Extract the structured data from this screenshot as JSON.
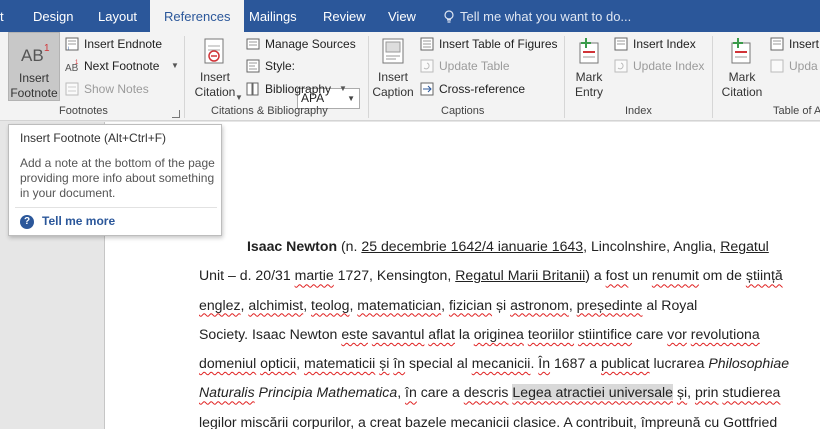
{
  "tabs": [
    {
      "label": "t"
    },
    {
      "label": "Design"
    },
    {
      "label": "Layout"
    },
    {
      "label": "References"
    },
    {
      "label": "Mailings"
    },
    {
      "label": "Review"
    },
    {
      "label": "View"
    }
  ],
  "tell_me": {
    "placeholder": "Tell me what you want to do..."
  },
  "ribbon": {
    "footnotes": {
      "insert_footnote": "Insert\nFootnote",
      "insert_endnote": "Insert Endnote",
      "next_footnote": "Next Footnote",
      "show_notes": "Show Notes",
      "title": "Footnotes"
    },
    "citations": {
      "insert_citation": "Insert\nCitation",
      "manage_sources": "Manage Sources",
      "style_label": "Style:",
      "style_value": "APA",
      "bibliography": "Bibliography",
      "title": "Citations & Bibliography"
    },
    "captions": {
      "insert_caption": "Insert\nCaption",
      "insert_table_of_figures": "Insert Table of Figures",
      "update_table": "Update Table",
      "cross_reference": "Cross-reference",
      "title": "Captions"
    },
    "index": {
      "mark_entry": "Mark\nEntry",
      "insert_index": "Insert Index",
      "update_index": "Update Index",
      "title": "Index"
    },
    "toa": {
      "mark_citation": "Mark\nCitation",
      "insert": "Insert",
      "update": "Upda",
      "title": "Table of A"
    }
  },
  "tooltip": {
    "title": "Insert Footnote (Alt+Ctrl+F)",
    "body": "Add a note at the bottom of the page providing more info about something in your document.",
    "link": "Tell me more"
  },
  "document": {
    "lines": [
      [
        {
          "t": "Isaac Newton",
          "s": "b"
        },
        {
          "t": " (n. "
        },
        {
          "t": "25 decembrie 1642/4 ianuarie 1643",
          "s": "ul"
        },
        {
          "t": ", Lincolnshire, Anglia, "
        },
        {
          "t": "Regatul",
          "s": "ul"
        }
      ],
      [
        {
          "t": "Unit – d. 20/31 "
        },
        {
          "t": "martie",
          "s": "sq"
        },
        {
          "t": " 1727, Kensington, "
        },
        {
          "t": "Regatul Marii Britanii",
          "s": "ul"
        },
        {
          "t": ") a "
        },
        {
          "t": "fost",
          "s": "sq"
        },
        {
          "t": " un "
        },
        {
          "t": "renumit",
          "s": "sq"
        },
        {
          "t": " om de "
        },
        {
          "t": "știință",
          "s": "sq"
        }
      ],
      [
        {
          "t": "englez",
          "s": "sq"
        },
        {
          "t": ", "
        },
        {
          "t": "alchimist",
          "s": "sq"
        },
        {
          "t": ", "
        },
        {
          "t": "teolog",
          "s": "sq"
        },
        {
          "t": ", "
        },
        {
          "t": "matematician",
          "s": "sq"
        },
        {
          "t": ", "
        },
        {
          "t": "fizician",
          "s": "sq"
        },
        {
          "t": " și "
        },
        {
          "t": "astronom",
          "s": "sq"
        },
        {
          "t": ", "
        },
        {
          "t": "președinte",
          "s": "sq"
        },
        {
          "t": " al Royal"
        }
      ],
      [
        {
          "t": "Society. Isaac Newton "
        },
        {
          "t": "este",
          "s": "sq"
        },
        {
          "t": " "
        },
        {
          "t": "savantul",
          "s": "sq"
        },
        {
          "t": " "
        },
        {
          "t": "aflat",
          "s": "sq"
        },
        {
          "t": " la "
        },
        {
          "t": "originea",
          "s": "sq"
        },
        {
          "t": " "
        },
        {
          "t": "teoriilor",
          "s": "sq"
        },
        {
          "t": " "
        },
        {
          "t": "stiintifice",
          "s": "sq"
        },
        {
          "t": " care "
        },
        {
          "t": "vor",
          "s": "sq"
        },
        {
          "t": " "
        },
        {
          "t": "revolutiona",
          "s": "sq"
        }
      ],
      [
        {
          "t": "domeniul",
          "s": "sq"
        },
        {
          "t": " "
        },
        {
          "t": "opticii",
          "s": "sq"
        },
        {
          "t": ", "
        },
        {
          "t": "matematicii",
          "s": "sq"
        },
        {
          "t": " "
        },
        {
          "t": "și",
          "s": "sq"
        },
        {
          "t": " "
        },
        {
          "t": "în",
          "s": "sq"
        },
        {
          "t": " special al "
        },
        {
          "t": "mecanicii",
          "s": "sq"
        },
        {
          "t": ". "
        },
        {
          "t": "În",
          "s": "sq"
        },
        {
          "t": " 1687 a "
        },
        {
          "t": "publicat",
          "s": "sq"
        },
        {
          "t": " lucrarea "
        },
        {
          "t": "Philosophiae",
          "s": "i"
        }
      ],
      [
        {
          "t": "Naturalis",
          "s": "i sq"
        },
        {
          "t": " Principia Mathematica",
          "s": "i"
        },
        {
          "t": ", "
        },
        {
          "t": "în",
          "s": "sq"
        },
        {
          "t": " care a "
        },
        {
          "t": "descris",
          "s": "sq"
        },
        {
          "t": " "
        },
        {
          "t": "Legea atractiei universale",
          "s": "sq hl"
        },
        {
          "t": " "
        },
        {
          "t": "și",
          "s": "sq"
        },
        {
          "t": ", "
        },
        {
          "t": "prin",
          "s": "sq"
        },
        {
          "t": " "
        },
        {
          "t": "studierea",
          "s": "sq"
        }
      ],
      [
        {
          "t": "legilor",
          "s": "sq"
        },
        {
          "t": " "
        },
        {
          "t": "miscării",
          "s": "sq"
        },
        {
          "t": " "
        },
        {
          "t": "corpurilor",
          "s": "sq"
        },
        {
          "t": ", a "
        },
        {
          "t": "creat",
          "s": "sq"
        },
        {
          "t": " "
        },
        {
          "t": "bazele",
          "s": "sq"
        },
        {
          "t": " "
        },
        {
          "t": "mecanicii",
          "s": "sq"
        },
        {
          "t": " "
        },
        {
          "t": "clasice",
          "s": "sq"
        },
        {
          "t": ". A "
        },
        {
          "t": "contribuit",
          "s": "sq"
        },
        {
          "t": ", "
        },
        {
          "t": "împreună",
          "s": "sq"
        },
        {
          "t": " cu Gottfried"
        }
      ]
    ]
  },
  "colors": {
    "accent": "#2b579a",
    "spellcheck": "#e02020"
  }
}
